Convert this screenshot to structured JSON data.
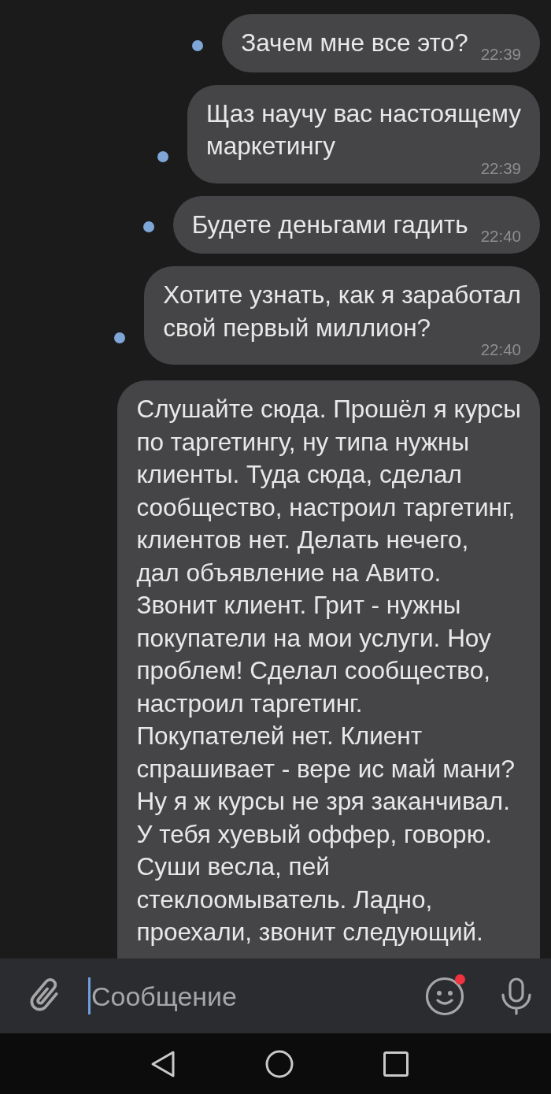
{
  "messages": [
    {
      "text": "Зачем мне все это?",
      "time": "22:39",
      "unread": true
    },
    {
      "text": "Щаз научу вас настоящему\nмаркетингу",
      "time": "22:39",
      "unread": true
    },
    {
      "text": "Будете деньгами гадить",
      "time": "22:40",
      "unread": true
    },
    {
      "text": "Хотите узнать, как я заработал\nсвой первый миллион?",
      "time": "22:40",
      "unread": true
    },
    {
      "text": "Слушайте сюда. Прошёл я курсы\nпо таргетингу, ну типа нужны\nклиенты. Туда сюда, сделал\nсообщество, настроил таргетинг,\nклиентов нет. Делать нечего,\nдал объявление на Авито.\nЗвонит клиент. Грит - нужны\nпокупатели на мои услуги. Ноу\nпроблем! Сделал сообщество,\nнастроил таргетинг.\nПокупателей нет. Клиент\nспрашивает - вере ис май мани?\nНу я ж курсы не зря заканчивал.\nУ тебя хуевый оффер, говорю.\nСуши весла, пей\nстеклоомыватель. Ладно,\nпроехали, звонит следующий."
    }
  ],
  "composer": {
    "placeholder": "Сообщение",
    "focused": true,
    "emoji_badge": true
  }
}
